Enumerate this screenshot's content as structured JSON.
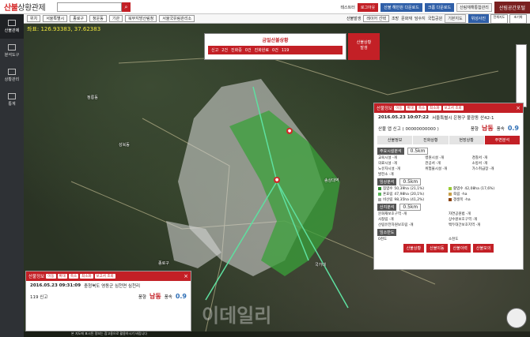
{
  "app": {
    "logo_main": "산불",
    "logo_sub": "상황관제",
    "search_placeholder": "",
    "search_icon": "search-icon"
  },
  "topbar": {
    "tester_label": "테스트터",
    "logout": "로그아웃",
    "btn1": "산불 해빈원 다운로드",
    "btn2": "크롬 다운로드",
    "btn3": "산림재해통합관리",
    "login_box": "산림공간포털"
  },
  "subbar": {
    "region_label": "위치",
    "region1": "서울특별시",
    "region2": "종로구",
    "region3": "청운동",
    "office_label": "기관",
    "office1": "북부지방산림청",
    "office2": "서울국유림관리소",
    "fire_label": "산불발생",
    "layer_label": "레이어 선택",
    "chk1": "조망",
    "chk2": "문화재",
    "chk3": "담수지",
    "chk4": "국립공원",
    "basic_map": "기본지도",
    "satellite": "위성사진"
  },
  "round_btns": [
    "전체지도",
    "초기화"
  ],
  "sidebar": [
    {
      "label": "산불관제"
    },
    {
      "label": "분석도구"
    },
    {
      "label": "상황관리"
    },
    {
      "label": "통계"
    }
  ],
  "map": {
    "coords": "좌표: 126.93383, 37.62383",
    "labels": [
      "정릉동",
      "성북동",
      "종로구",
      "국가대",
      "송상대역"
    ]
  },
  "status_top": {
    "title": "금일산불상황",
    "items": [
      {
        "label": "신고",
        "value": "2건"
      },
      {
        "label": "진화중",
        "value": "0건"
      },
      {
        "label": "진화완료",
        "value": "0건"
      }
    ],
    "count": "119"
  },
  "toggle": {
    "line1": "산불상황",
    "line2": "발생"
  },
  "detail": {
    "header": "산불정보",
    "header_btns": [
      "이동",
      "확대",
      "축소",
      "최소화",
      "보고서 조회"
    ],
    "date": "2016.05.23 10:07:22",
    "address": "서울특별시 은평구 불광동 산42-1",
    "report": "산불 앱 신고 ( 00000000000 )",
    "dir_label": "풍향",
    "dir_value": "남동",
    "speed_label": "풍속",
    "speed_value": "0.9",
    "tabs": [
      "산불정보",
      "진화상황",
      "현장상황",
      "주변분석"
    ],
    "sec1": "주요시설분석",
    "sec1_sel": "0.5km",
    "facilities": [
      "교육시설 -개",
      "병원시설 -개",
      "경찰서 -개",
      "의료시설 -개",
      "관공서 -개",
      "소방서 -개",
      "노유자시설 -개",
      "위험물시설 -개",
      "가스취급장 -개",
      "발전소 -개"
    ],
    "sec2": "임상분석",
    "sec2_sel": "0.5km",
    "forest": [
      {
        "name": "침엽수",
        "value": "50,39ha (21,1%)"
      },
      {
        "name": "활엽수",
        "value": "42,08ha (17,6%)"
      },
      {
        "name": "혼효림",
        "value": "47,98ha (20,1%)"
      },
      {
        "name": "죽림",
        "value": "-ha"
      },
      {
        "name": "비산림",
        "value": "98,35ha (41,2%)"
      },
      {
        "name": "갱생목",
        "value": "-ha"
      }
    ],
    "sec3": "산지분석",
    "sec3_sel": "0.5km",
    "mountain": [
      "문화재보호구역 -개",
      "자연공원법 -개",
      "사찰림 -개",
      "상수원보호구역 -개",
      "산림유전자원보호림 -개",
      "백두대간보호지역 -개"
    ],
    "sec4": "임소반도",
    "sec4_items": [
      "0천도",
      "소천도"
    ],
    "bottom_btns": [
      "산불상황",
      "산불이동",
      "산불이력",
      "산불모의"
    ]
  },
  "bottom": {
    "header": "산불정보",
    "header_btns": [
      "이동",
      "확대",
      "축소",
      "최소화",
      "보고서 조회"
    ],
    "date": "2016.05.23 09:31:09",
    "address": "충청북도 영동군 심천면 심천리",
    "report": "119 신고",
    "dir_label": "풍향",
    "dir_value": "남동",
    "speed_label": "풍속",
    "speed_value": "0.9"
  },
  "watermark": "이데일리",
  "footer": "본 지도에 표시된 정보는 참고용으로 활용하시기 바랍니다",
  "colors": {
    "brand": "#c32026",
    "blue": "#2f6fb6"
  }
}
